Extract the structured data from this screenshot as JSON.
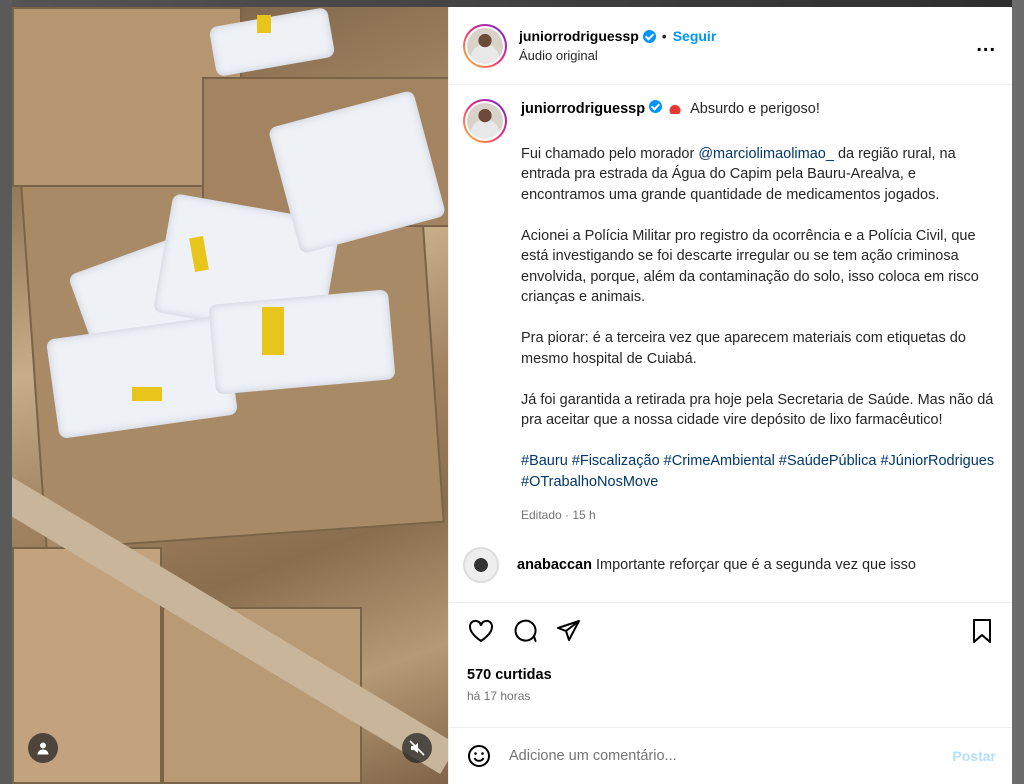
{
  "post": {
    "username": "juniorrodriguessp",
    "follow_label": "Seguir",
    "dot": "•",
    "subtitle": "Áudio original",
    "more_icon": "..."
  },
  "caption": {
    "username": "juniorrodriguessp",
    "headline": "Absurdo e perigoso!",
    "p1_before": "Fui chamado pelo morador ",
    "p1_mention": "@marciolimaolimao_",
    "p1_after": " da região rural, na entrada pra estrada da Água do Capim pela Bauru-Arealva, e encontramos uma grande quantidade de medicamentos jogados.",
    "p2": "Acionei a Polícia Militar pro registro da ocorrência e a Polícia Civil, que está investigando se foi descarte irregular ou se tem ação criminosa envolvida, porque, além da contaminação do solo, isso coloca em risco crianças e animais.",
    "p3": "Pra piorar: é a terceira vez que aparecem materiais com etiquetas do mesmo hospital de Cuiabá.",
    "p4": "Já foi garantida a retirada pra hoje pela Secretaria de Saúde. Mas não dá pra aceitar que a nossa cidade vire depósito de lixo farmacêutico!",
    "hashtags": "#Bauru #Fiscalização #CrimeAmbiental #SaúdePública #JúniorRodrigues #OTrabalhoNosMove",
    "meta": "Editado · 15 h"
  },
  "comment": {
    "username": "anabaccan",
    "text": "Importante reforçar que é a segunda vez que isso"
  },
  "stats": {
    "likes": "570 curtidas",
    "time": "há 17 horas"
  },
  "composer": {
    "placeholder": "Adicione um comentário...",
    "post_label": "Postar"
  },
  "colors": {
    "accent": "#0095f6",
    "link": "#00376b",
    "muted": "#737373"
  },
  "icons": [
    "user-tag-icon",
    "mute-icon",
    "heart-icon",
    "comment-icon",
    "share-icon",
    "bookmark-icon",
    "emoji-icon",
    "verified-icon",
    "siren-icon"
  ]
}
